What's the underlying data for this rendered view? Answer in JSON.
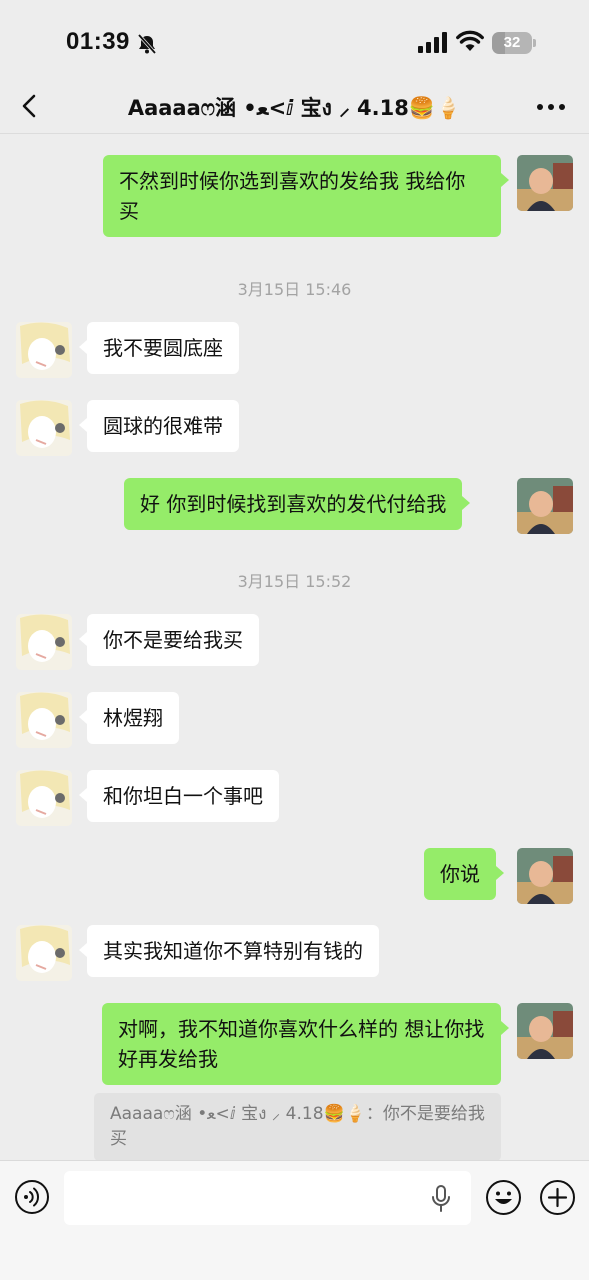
{
  "status_bar": {
    "time": "01:39",
    "battery": "32",
    "battery_level": 0.32,
    "icons": [
      "bell-muted-icon",
      "signal-icon",
      "wifi-icon",
      "battery-icon"
    ]
  },
  "nav": {
    "title": "Aaaaaෆ涵 •ﻌ<ⅈ 宝ง ⸝ 4.18🍔🍦",
    "back_icon": "chevron-left-icon",
    "more_icon": "more-dots-icon"
  },
  "messages": [
    {
      "side": "out",
      "text": "不然到时候你选到喜欢的发给我 我给你买"
    },
    {
      "type": "time",
      "text": "3月15日 15:46"
    },
    {
      "side": "in",
      "text": "我不要圆底座"
    },
    {
      "side": "in",
      "text": "圆球的很难带"
    },
    {
      "side": "out",
      "text": "好 你到时候找到喜欢的发代付给我"
    },
    {
      "type": "time",
      "text": "3月15日 15:52"
    },
    {
      "side": "in",
      "text": "你不是要给我买"
    },
    {
      "side": "in",
      "text": "林煜翔"
    },
    {
      "side": "in",
      "text": "和你坦白一个事吧"
    },
    {
      "side": "out",
      "text": "你说"
    },
    {
      "side": "in",
      "text": "其实我知道你不算特别有钱的"
    },
    {
      "side": "out",
      "text": "对啊，我不知道你喜欢什么样的 想让你找好再发给我"
    }
  ],
  "quote": {
    "text": "Aaaaaෆ涵 •ﻌ<ⅈ 宝ง ⸝ 4.18🍔🍦：你不是要给我买"
  },
  "input_bar": {
    "voice_icon": "voice-icon",
    "mic_icon": "microphone-icon",
    "emoji_icon": "emoji-icon",
    "plus_icon": "plus-icon"
  }
}
